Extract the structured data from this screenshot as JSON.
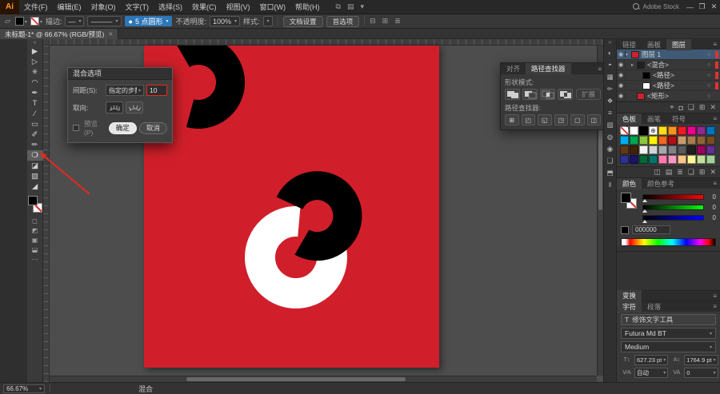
{
  "colors": {
    "artboard-red": "#d01f2a",
    "accent-blue": "#2d76b8",
    "annotation-red": "#e8291c",
    "selection-red": "#e13232",
    "shape-black": "#000000",
    "shape-white": "#ffffff"
  },
  "ui": {
    "arrow": "▾",
    "menu": "≡",
    "expand": "«"
  },
  "menubar": {
    "logo": "Ai",
    "items": [
      "文件(F)",
      "编辑(E)",
      "对象(O)",
      "文字(T)",
      "选择(S)",
      "效果(C)",
      "视图(V)",
      "窗口(W)",
      "帮助(H)"
    ],
    "quick_icons": [
      {
        "name": "arrange-documents-icon",
        "glyph": "⧉"
      },
      {
        "name": "workspace-switcher-icon",
        "glyph": "▤"
      },
      {
        "name": "workspace-arrow-icon",
        "glyph": "▾"
      }
    ],
    "search_label": "Adobe Stock",
    "window_controls": [
      {
        "name": "minimize-button",
        "glyph": "—"
      },
      {
        "name": "maximize-button",
        "glyph": "❐"
      },
      {
        "name": "close-button",
        "glyph": "✕"
      }
    ]
  },
  "controlbar": {
    "path_icon": "▱",
    "stroke_label": "描边:",
    "stroke_weight": "—",
    "brush_preview": "———",
    "brush_dot": "●",
    "brush_value": "5 点圆形",
    "opacity_label": "不透明度:",
    "opacity_value": "100%",
    "style_label": "样式:",
    "doc_setup_button": "文档设置",
    "preferences_button": "首选项",
    "right_icons": [
      {
        "name": "align-icon",
        "glyph": "⊟"
      },
      {
        "name": "distribute-icon",
        "glyph": "⊞"
      },
      {
        "name": "options-icon",
        "glyph": "≣"
      }
    ]
  },
  "doc_tab": {
    "title": "未标题-1* @ 66.67% (RGB/预览)",
    "close": "✕"
  },
  "toolbar": {
    "tools_top": [
      {
        "name": "selection-tool",
        "glyph": "▶"
      },
      {
        "name": "direct-selection-tool",
        "glyph": "▷"
      },
      {
        "name": "magic-wand-tool",
        "glyph": "✳"
      },
      {
        "name": "lasso-tool",
        "glyph": "◠"
      },
      {
        "name": "pen-tool",
        "glyph": "✒"
      },
      {
        "name": "type-tool",
        "glyph": "T"
      },
      {
        "name": "line-segment-tool",
        "glyph": "∕"
      },
      {
        "name": "rectangle-tool",
        "glyph": "▭"
      },
      {
        "name": "paintbrush-tool",
        "glyph": "✐"
      },
      {
        "name": "pencil-tool",
        "glyph": "✏"
      }
    ],
    "blend_tool": {
      "name": "blend-tool",
      "glyph": "❍"
    },
    "tools_bottom": [
      {
        "name": "eraser-tool",
        "glyph": "◪"
      },
      {
        "name": "gradient-tool",
        "glyph": "▨"
      },
      {
        "name": "eyedropper-tool",
        "glyph": "◢"
      }
    ],
    "modes": [
      {
        "name": "draw-normal-mode-icon",
        "glyph": "◻"
      },
      {
        "name": "draw-behind-mode-icon",
        "glyph": "◩"
      },
      {
        "name": "draw-inside-mode-icon",
        "glyph": "▣"
      },
      {
        "name": "screen-mode-icon",
        "glyph": "⬓"
      },
      {
        "name": "edit-toolbar-icon",
        "glyph": "⋯"
      }
    ]
  },
  "dialog": {
    "title": "混合选项",
    "spacing_label": "间距(S):",
    "spacing_value": "指定的步数",
    "steps_value": "10",
    "orientation_label": "取向:",
    "preview_label": "预览(P)",
    "ok_button": "确定",
    "cancel_button": "取消"
  },
  "pathfinder": {
    "tabs": {
      "align": "对齐",
      "pathfinder": "路径查找器"
    },
    "shape_modes_label": "形状模式:",
    "expand_button": "扩展",
    "pathfinder_label": "路径查找器:",
    "pathfinder_icons": [
      {
        "name": "divide-icon",
        "glyph": "⊞"
      },
      {
        "name": "trim-icon",
        "glyph": "◰"
      },
      {
        "name": "merge-icon",
        "glyph": "◱"
      },
      {
        "name": "crop-icon",
        "glyph": "◳"
      },
      {
        "name": "outline-icon",
        "glyph": "▢"
      },
      {
        "name": "minus-back-icon",
        "glyph": "◫"
      }
    ]
  },
  "right_strip": {
    "icons": [
      {
        "name": "color-panel-icon",
        "glyph": "◐"
      },
      {
        "name": "color-guide-panel-icon",
        "glyph": "◓"
      },
      {
        "name": "swatches-panel-icon",
        "glyph": "▦"
      },
      {
        "name": "brushes-panel-icon",
        "glyph": "✏"
      },
      {
        "name": "symbols-panel-icon",
        "glyph": "❖"
      },
      {
        "name": "stroke-panel-icon",
        "glyph": "≡"
      },
      {
        "name": "gradient-panel-icon",
        "glyph": "▧"
      },
      {
        "name": "transparency-panel-icon",
        "glyph": "◍"
      },
      {
        "name": "appearance-panel-icon",
        "glyph": "◉"
      },
      {
        "name": "graphic-styles-panel-icon",
        "glyph": "❑"
      },
      {
        "name": "artboards-panel-icon",
        "glyph": "⬒"
      },
      {
        "name": "align-panel-icon",
        "glyph": "‖"
      }
    ]
  },
  "dock": {
    "layers": {
      "tabs": [
        "链接",
        "画板",
        "图层"
      ],
      "rows": [
        {
          "label": "图层 1",
          "eye": "◉",
          "arrow": "▾",
          "pad": "0px",
          "thumb": "#d01f2a",
          "bg": "#3f5a75",
          "chip": "#e13232",
          "target": "○"
        },
        {
          "label": "<混合>",
          "eye": "◉",
          "arrow": "▸",
          "pad": "7px",
          "thumb": "#202020",
          "bg": "",
          "chip": "#e13232",
          "target": "○"
        },
        {
          "label": "<路径>",
          "eye": "◉",
          "arrow": "",
          "pad": "14px",
          "thumb": "#000000",
          "bg": "",
          "chip": "#e13232",
          "target": "○"
        },
        {
          "label": "<路径>",
          "eye": "◉",
          "arrow": "",
          "pad": "14px",
          "thumb": "#ffffff",
          "bg": "",
          "chip": "#e13232",
          "target": "○"
        },
        {
          "label": "<矩形>",
          "eye": "◉",
          "arrow": "",
          "pad": "7px",
          "thumb": "#d01f2a",
          "bg": "",
          "chip": "",
          "target": "○"
        }
      ],
      "footer_icons": [
        {
          "name": "locate-object-icon",
          "glyph": "⌖"
        },
        {
          "name": "make-clipping-mask-icon",
          "glyph": "◘"
        },
        {
          "name": "new-sublayer-icon",
          "glyph": "❏"
        },
        {
          "name": "new-layer-icon",
          "glyph": "⊞"
        },
        {
          "name": "delete-layer-icon",
          "glyph": "✕"
        }
      ]
    },
    "swatches": {
      "tabs": [
        "色板",
        "画笔",
        "符号"
      ],
      "reg_glyph": "⊕",
      "colors": [
        "#ffde17",
        "#f7941d",
        "#ed1c24",
        "#ec008c",
        "#92278f",
        "#0072bc",
        "#00aeef",
        "#00a651",
        "#8dc63f",
        "#fff200",
        "#f26522",
        "#b11016",
        "#c69c6d",
        "#a67c52",
        "#8c6239",
        "#754c24",
        "#603913",
        "#42210b",
        "#f1f2f2",
        "#d1d3d4",
        "#a7a9ac",
        "#808285",
        "#58595b",
        "#231f20",
        "#9e005d",
        "#662d91",
        "#2e3192",
        "#1b1464",
        "#006837",
        "#00746b",
        "#ff7bac",
        "#f49ac1",
        "#fdc689",
        "#fff799",
        "#c4df9b",
        "#a3d39c"
      ],
      "footer_icons": [
        {
          "name": "swatch-libraries-icon",
          "glyph": "◫"
        },
        {
          "name": "swatch-kinds-icon",
          "glyph": "▤"
        },
        {
          "name": "swatch-options-icon",
          "glyph": "≣"
        },
        {
          "name": "new-color-group-icon",
          "glyph": "❏"
        },
        {
          "name": "new-swatch-icon",
          "glyph": "⊞"
        },
        {
          "name": "delete-swatch-icon",
          "glyph": "✕"
        }
      ]
    },
    "color": {
      "tabs": [
        "颜色",
        "颜色参考"
      ],
      "sliders": {
        "r": "0",
        "g": "0",
        "b": "0"
      },
      "hex_value": "000000"
    },
    "transform_header": {
      "label": "变换"
    },
    "character": {
      "tabs": [
        "字符",
        "段落"
      ],
      "touch_icon": "T",
      "touch_type_button": "修饰文字工具",
      "font_value": "Futura Md BT",
      "style_value": "Medium",
      "fields": [
        {
          "name": "font-size-field",
          "icon": "T↕",
          "value": "627.23 pt"
        },
        {
          "name": "leading-field",
          "icon": "A↕",
          "value": "1764.9 pt"
        },
        {
          "name": "kerning-field",
          "icon": "V∕A",
          "value": "自动"
        },
        {
          "name": "tracking-field",
          "icon": "VA",
          "value": "0"
        }
      ]
    }
  },
  "statusbar": {
    "zoom": "66.67%",
    "tool_label": "混合"
  }
}
